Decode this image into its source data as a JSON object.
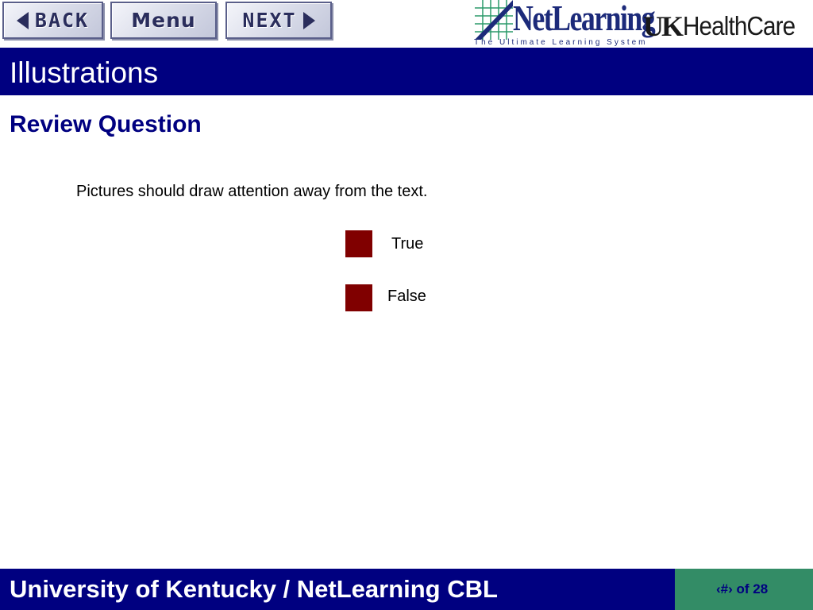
{
  "nav": {
    "back_label": "BACK",
    "menu_label": "Menu",
    "next_label": "NEXT"
  },
  "branding": {
    "netlearning": "NetLearning",
    "netlearning_tagline": "The Ultimate Learning System",
    "uk": "UK",
    "healthcare": "HealthCare"
  },
  "page": {
    "title": "Illustrations",
    "subheading": "Review Question",
    "question": "Pictures should draw attention away from the text."
  },
  "options": {
    "true_label": "True",
    "false_label": "False"
  },
  "footer": {
    "text": "University of Kentucky / NetLearning CBL",
    "page_indicator": "‹#› of 28"
  },
  "colors": {
    "header_bar": "#000080",
    "option_box": "#800000",
    "page_box": "#338c66"
  }
}
